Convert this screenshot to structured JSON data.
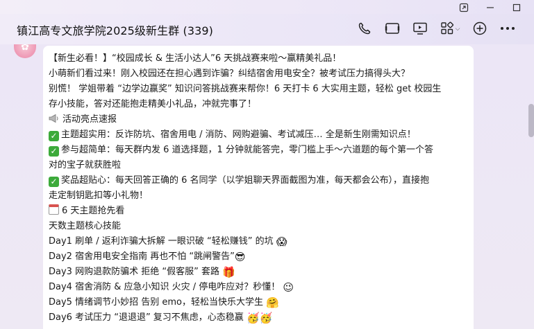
{
  "header": {
    "title": "镇江高专文旅学院2025级新生群 (339)"
  },
  "icons": {
    "window": [
      "pin-icon",
      "minimize-icon",
      "maximize-icon"
    ],
    "toolbar": [
      "phone-icon",
      "video-icon",
      "screen-share-icon",
      "apps-grid-icon",
      "chevron-down-icon",
      "add-icon",
      "more-icon"
    ]
  },
  "message": {
    "lines": [
      "【新生必看！】“校园成长 & 生活小达人”6 天挑战赛来啦～赢精美礼品！",
      "小萌新们看过来！刚入校园还在担心遇到诈骗？纠结宿舍用电安全？被考试压力搞得头大？",
      "别慌！ 学姐带着 “边学边赢奖” 知识问答挑战赛来帮你！6 天打卡 6 大实用主题，轻松 get 校园生",
      "存小技能，答对还能抱走精美小礼品，冲就完事了！"
    ],
    "highlights_title": "活动亮点速报",
    "highlights": [
      "主题超实用：反诈防坑、宿舍用电 / 消防、网购避骗、考试减压… 全是新生刚需知识点！",
      "参与超简单：每天群内发 6 道选择题，1 分钟就能答完，零门槛上手～六道题的每个第一个答",
      "对的宝子就获胜啦",
      "奖品超贴心：每天回答正确的 6 名同学（以学姐聊天界面截图为准，每天都会公布），直接抱",
      "走定制钥匙扣等小礼物！"
    ],
    "schedule_title": "6 天主题抢先看",
    "schedule_subtitle": "天数主题核心技能",
    "days": [
      "Day1 刷单 / 返利诈骗大拆解 一眼识破 “轻松赚钱” 的坑",
      "Day2 宿舍用电安全指南 再也不怕 “跳闸警告”",
      "Day3 网购退款防骗术 拒绝 “假客服” 套路",
      "Day4 宿舍消防 & 应急小知识 火灾 / 停电咋应对？秒懂！",
      "Day5 情绪调节小妙招 告别 emo，轻松当快乐大学生",
      "Day6 考试压力 “退退退” 复习不焦虑，心态稳赢"
    ],
    "day_emojis": [
      "😱",
      "😎",
      "🎁",
      "😉",
      "🤗",
      "🥳🥳"
    ]
  },
  "colors": {
    "accent_check": "#3caa3a",
    "bubble": "#ffffff",
    "background": "#ece6f6"
  }
}
